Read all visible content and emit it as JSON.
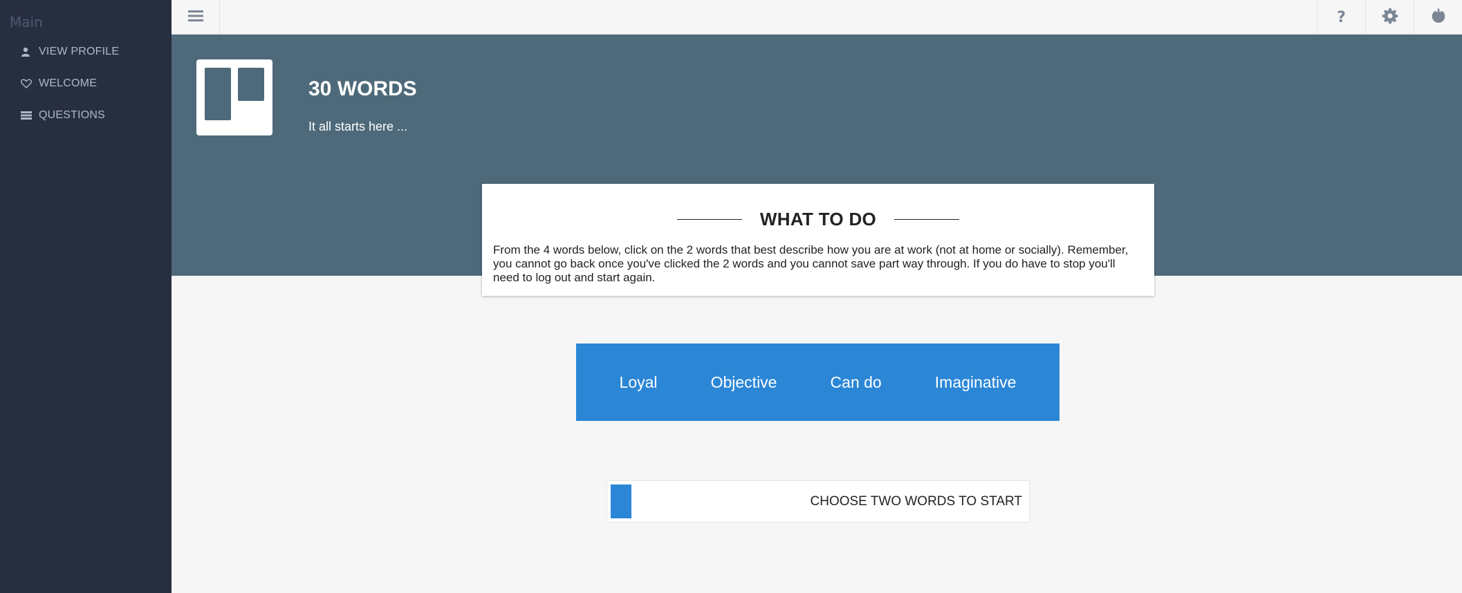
{
  "sidebar": {
    "heading": "Main",
    "items": [
      {
        "label": "VIEW PROFILE",
        "icon": "user-icon"
      },
      {
        "label": "WELCOME",
        "icon": "heart-icon"
      },
      {
        "label": "QUESTIONS",
        "icon": "list-icon"
      }
    ]
  },
  "topbar": {
    "help_label": "?",
    "icons": [
      "menu-icon",
      "help-icon",
      "gear-icon",
      "power-icon"
    ]
  },
  "hero": {
    "title": "30 WORDS",
    "subtitle": "It all starts here ..."
  },
  "instructions": {
    "heading": "WHAT TO DO",
    "body": "From the 4 words below, click on the 2 words that best describe how you are at work (not at home or socially). Remember, you cannot go back once you've clicked the 2 words and you cannot save part way through. If you do have to stop you'll need to log out and start again."
  },
  "words": [
    "Loyal",
    "Objective",
    "Can do",
    "Imaginative"
  ],
  "progress": {
    "label": "CHOOSE TWO WORDS TO START",
    "fraction": 0.05
  },
  "colors": {
    "sidebar_bg": "#272e40",
    "hero_bg": "#4e6a7a",
    "accent": "#2b86d6",
    "page_bg": "#f6f6f6"
  }
}
